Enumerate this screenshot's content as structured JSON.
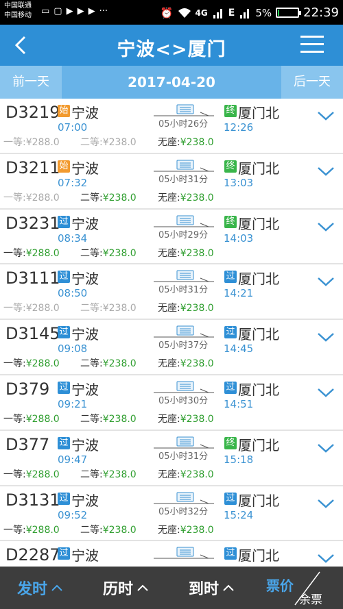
{
  "status": {
    "carrier1": "中国联通",
    "carrier2": "中国移动",
    "network": "4G",
    "battery": "5%",
    "battery_level": 0.05,
    "time": "22:39",
    "icons": [
      "message-icon",
      "chat-icon",
      "media-play-icon",
      "media-play-icon",
      "media-play-icon",
      "more-icon",
      "alarm-icon",
      "wifi-icon",
      "signal-icon",
      "signal-icon",
      "battery-icon"
    ]
  },
  "nav": {
    "title": "宁波<>厦门"
  },
  "datebar": {
    "prev": "前一天",
    "date": "2017-04-20",
    "next": "后一天"
  },
  "trains": [
    {
      "no": "D3219",
      "dep_type": "始",
      "dep_kind": "start",
      "dep_station": "宁波",
      "dep_time": "07:00",
      "duration": "05小时26分",
      "arr_type": "终",
      "arr_kind": "end",
      "arr_station": "厦门北",
      "arr_time": "12:26",
      "seat1_label": "一等:",
      "seat1_price": "¥288.0",
      "seat1_avail": false,
      "seat2_label": "二等:",
      "seat2_price": "¥238.0",
      "seat2_avail": false,
      "seat3_label": "无座:",
      "seat3_price": "¥238.0",
      "seat3_avail": true
    },
    {
      "no": "D3211",
      "dep_type": "始",
      "dep_kind": "start",
      "dep_station": "宁波",
      "dep_time": "07:32",
      "duration": "05小时31分",
      "arr_type": "终",
      "arr_kind": "end",
      "arr_station": "厦门北",
      "arr_time": "13:03",
      "seat1_label": "一等:",
      "seat1_price": "¥288.0",
      "seat1_avail": false,
      "seat2_label": "二等:",
      "seat2_price": "¥238.0",
      "seat2_avail": true,
      "seat3_label": "无座:",
      "seat3_price": "¥238.0",
      "seat3_avail": true
    },
    {
      "no": "D3231",
      "dep_type": "过",
      "dep_kind": "pass",
      "dep_station": "宁波",
      "dep_time": "08:34",
      "duration": "05小时29分",
      "arr_type": "终",
      "arr_kind": "end",
      "arr_station": "厦门北",
      "arr_time": "14:03",
      "seat1_label": "一等:",
      "seat1_price": "¥288.0",
      "seat1_avail": true,
      "seat2_label": "二等:",
      "seat2_price": "¥238.0",
      "seat2_avail": true,
      "seat3_label": "无座:",
      "seat3_price": "¥238.0",
      "seat3_avail": true
    },
    {
      "no": "D3111",
      "dep_type": "过",
      "dep_kind": "pass",
      "dep_station": "宁波",
      "dep_time": "08:50",
      "duration": "05小时31分",
      "arr_type": "过",
      "arr_kind": "pass",
      "arr_station": "厦门北",
      "arr_time": "14:21",
      "seat1_label": "一等:",
      "seat1_price": "¥288.0",
      "seat1_avail": false,
      "seat2_label": "二等:",
      "seat2_price": "¥238.0",
      "seat2_avail": false,
      "seat3_label": "无座:",
      "seat3_price": "¥238.0",
      "seat3_avail": true
    },
    {
      "no": "D3145",
      "dep_type": "过",
      "dep_kind": "pass",
      "dep_station": "宁波",
      "dep_time": "09:08",
      "duration": "05小时37分",
      "arr_type": "过",
      "arr_kind": "pass",
      "arr_station": "厦门北",
      "arr_time": "14:45",
      "seat1_label": "一等:",
      "seat1_price": "¥288.0",
      "seat1_avail": true,
      "seat2_label": "二等:",
      "seat2_price": "¥238.0",
      "seat2_avail": true,
      "seat3_label": "无座:",
      "seat3_price": "¥238.0",
      "seat3_avail": true
    },
    {
      "no": "D379",
      "dep_type": "过",
      "dep_kind": "pass",
      "dep_station": "宁波",
      "dep_time": "09:21",
      "duration": "05小时30分",
      "arr_type": "过",
      "arr_kind": "pass",
      "arr_station": "厦门北",
      "arr_time": "14:51",
      "seat1_label": "一等:",
      "seat1_price": "¥288.0",
      "seat1_avail": true,
      "seat2_label": "二等:",
      "seat2_price": "¥238.0",
      "seat2_avail": true,
      "seat3_label": "无座:",
      "seat3_price": "¥238.0",
      "seat3_avail": true
    },
    {
      "no": "D377",
      "dep_type": "过",
      "dep_kind": "pass",
      "dep_station": "宁波",
      "dep_time": "09:47",
      "duration": "05小时31分",
      "arr_type": "终",
      "arr_kind": "end",
      "arr_station": "厦门北",
      "arr_time": "15:18",
      "seat1_label": "一等:",
      "seat1_price": "¥288.0",
      "seat1_avail": true,
      "seat2_label": "二等:",
      "seat2_price": "¥238.0",
      "seat2_avail": true,
      "seat3_label": "无座:",
      "seat3_price": "¥238.0",
      "seat3_avail": true
    },
    {
      "no": "D3131",
      "dep_type": "过",
      "dep_kind": "pass",
      "dep_station": "宁波",
      "dep_time": "09:52",
      "duration": "05小时32分",
      "arr_type": "过",
      "arr_kind": "pass",
      "arr_station": "厦门北",
      "arr_time": "15:24",
      "seat1_label": "一等:",
      "seat1_price": "¥288.0",
      "seat1_avail": true,
      "seat2_label": "二等:",
      "seat2_price": "¥238.0",
      "seat2_avail": true,
      "seat3_label": "无座:",
      "seat3_price": "¥238.0",
      "seat3_avail": true
    },
    {
      "no": "D2287",
      "dep_type": "过",
      "dep_kind": "pass",
      "dep_station": "宁波",
      "dep_time": "",
      "duration": "",
      "arr_type": "过",
      "arr_kind": "pass",
      "arr_station": "厦门北",
      "arr_time": "",
      "seat1_label": "",
      "seat1_price": "",
      "seat1_avail": true,
      "seat2_label": "",
      "seat2_price": "",
      "seat2_avail": true,
      "seat3_label": "",
      "seat3_price": "",
      "seat3_avail": true
    }
  ],
  "bottom": {
    "sort_departure": "发时",
    "sort_duration": "历时",
    "sort_arrival": "到时",
    "sort_price": "票价",
    "sort_remaining": "余票"
  },
  "colors": {
    "primary": "#2e8fd6",
    "available": "#2f9e2f",
    "unavailable": "#aaaaaa",
    "start_badge": "#f29a2e",
    "pass_badge": "#2e8fd6",
    "end_badge": "#39b54a"
  }
}
